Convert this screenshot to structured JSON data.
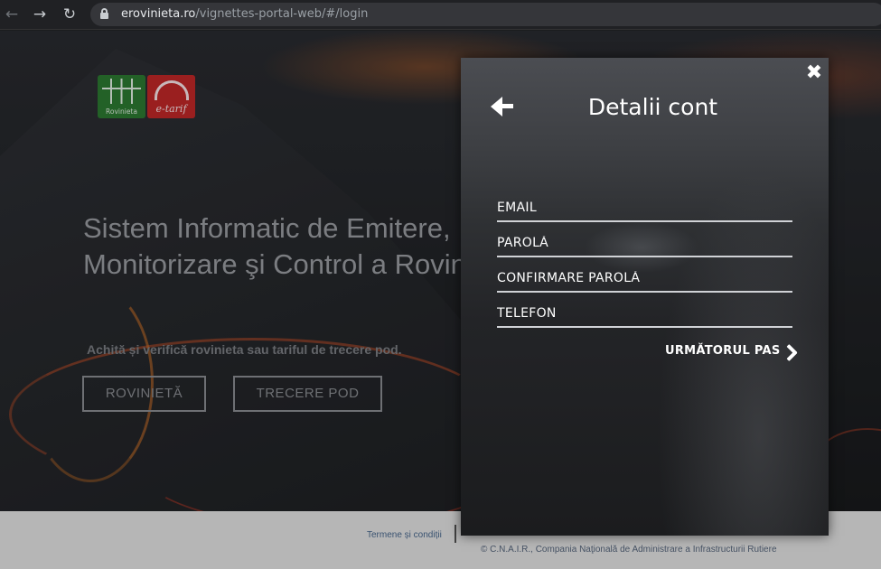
{
  "browser": {
    "nav": {
      "back": "←",
      "forward": "→",
      "reload": "↻"
    },
    "url_host": "erovinieta.ro",
    "url_path": "/vignettes-portal-web/#/login"
  },
  "site": {
    "logos": {
      "rovinieta_label": "Rovinieta",
      "etarif_label": "e-tarif"
    },
    "hero_title_line1": "Sistem Informatic de Emitere,",
    "hero_title_line2": "Monitorizare şi Control a Rovinietei",
    "hero_subtitle": "Achită și verifică rovinieta sau tariful de trecere pod.",
    "buttons": {
      "rovinieta": "ROVINIETĂ",
      "trecere_pod": "TRECERE POD"
    },
    "footer": {
      "terms": "Termene și condiții",
      "copyright": "© C.N.A.I.R., Compania Naţională de Administrare a Infrastructurii Rutiere"
    }
  },
  "modal": {
    "close_icon": "✖",
    "title": "Detalii cont",
    "fields": {
      "email": {
        "placeholder": "EMAIL",
        "value": ""
      },
      "password": {
        "placeholder": "PAROLĂ",
        "value": ""
      },
      "confirm_password": {
        "placeholder": "CONFIRMARE PAROLĂ",
        "value": ""
      },
      "phone": {
        "placeholder": "TELEFON",
        "value": ""
      }
    },
    "next_label": "URMĂTORUL PAS"
  },
  "colors": {
    "accent": "#ffffff",
    "footer_bg": "#e9e9ea",
    "rovinieta_green": "#2e7d32",
    "etarif_red": "#c62828"
  }
}
